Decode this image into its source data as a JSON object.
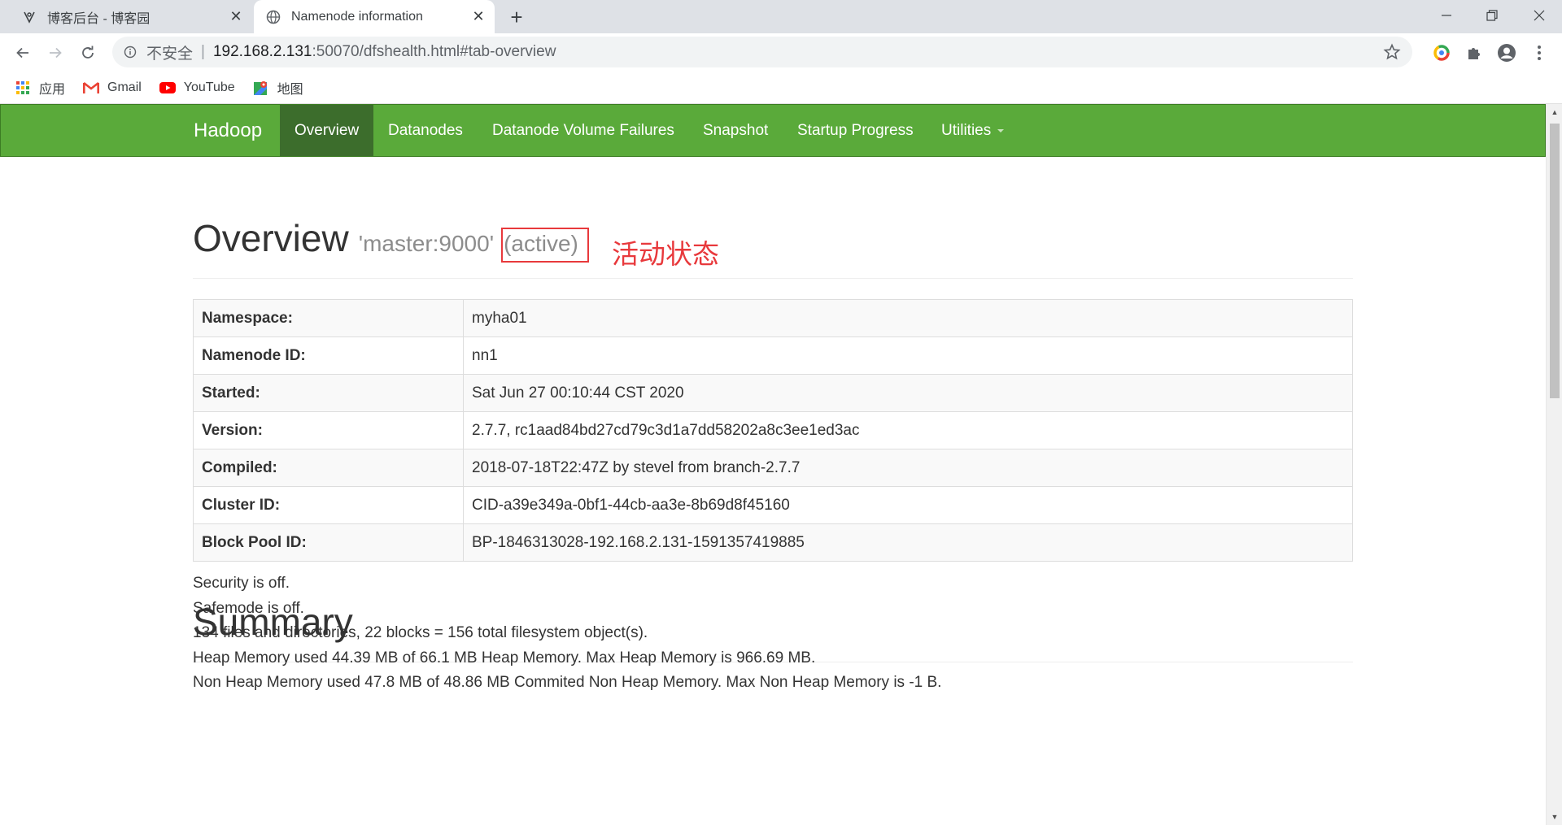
{
  "browser": {
    "tabs": [
      {
        "title": "博客后台 - 博客园",
        "active": false
      },
      {
        "title": "Namenode information",
        "active": true
      }
    ],
    "address": {
      "insecure_label": "不安全",
      "separator": "|",
      "host": "192.168.2.131",
      "rest": ":50070/dfshealth.html#tab-overview"
    },
    "bookmarks": [
      {
        "label": "应用",
        "icon": "apps-grid-icon"
      },
      {
        "label": "Gmail",
        "icon": "gmail-icon"
      },
      {
        "label": "YouTube",
        "icon": "youtube-icon"
      },
      {
        "label": "地图",
        "icon": "maps-icon"
      }
    ],
    "colors": {
      "tabstrip": "#dee1e6",
      "omnibox": "#f1f3f4"
    }
  },
  "navbar": {
    "brand": "Hadoop",
    "items": [
      {
        "label": "Overview",
        "active": true
      },
      {
        "label": "Datanodes"
      },
      {
        "label": "Datanode Volume Failures"
      },
      {
        "label": "Snapshot"
      },
      {
        "label": "Startup Progress"
      },
      {
        "label": "Utilities",
        "dropdown": true
      }
    ],
    "color": "#5aaa3a",
    "active_color": "#3c6d2c"
  },
  "overview": {
    "title": "Overview",
    "host": "'master:9000'",
    "state": "(active)",
    "annotation": "活动状态",
    "annotation_color": "#e8393c",
    "rows": [
      {
        "key": "Namespace:",
        "value": "myha01"
      },
      {
        "key": "Namenode ID:",
        "value": "nn1"
      },
      {
        "key": "Started:",
        "value": "Sat Jun 27 00:10:44 CST 2020"
      },
      {
        "key": "Version:",
        "value": "2.7.7, rc1aad84bd27cd79c3d1a7dd58202a8c3ee1ed3ac"
      },
      {
        "key": "Compiled:",
        "value": "2018-07-18T22:47Z by stevel from branch-2.7.7"
      },
      {
        "key": "Cluster ID:",
        "value": "CID-a39e349a-0bf1-44cb-aa3e-8b69d8f45160"
      },
      {
        "key": "Block Pool ID:",
        "value": "BP-1846313028-192.168.2.131-1591357419885"
      }
    ]
  },
  "summary": {
    "title": "Summary",
    "lines": [
      "Security is off.",
      "Safemode is off.",
      "134 files and directories, 22 blocks = 156 total filesystem object(s).",
      "Heap Memory used 44.39 MB of 66.1 MB Heap Memory. Max Heap Memory is 966.69 MB.",
      "Non Heap Memory used 47.8 MB of 48.86 MB Commited Non Heap Memory. Max Non Heap Memory is -1 B."
    ]
  }
}
